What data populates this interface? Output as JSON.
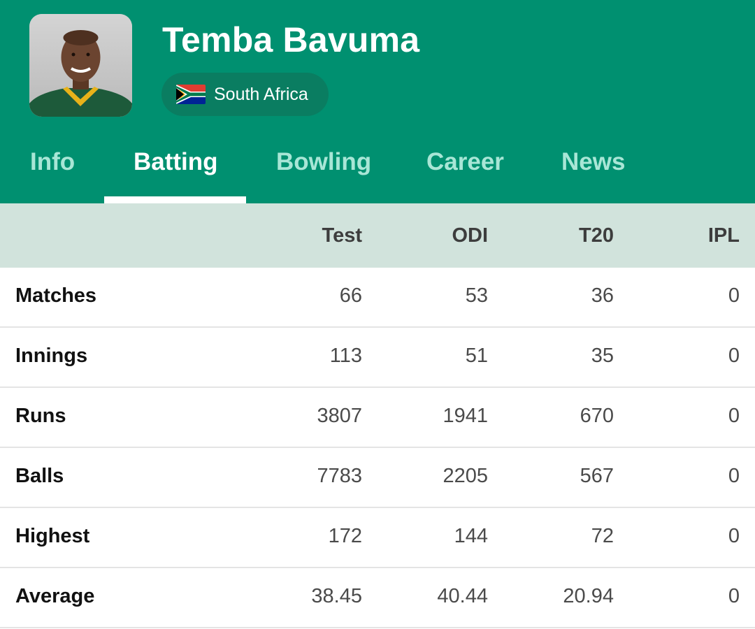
{
  "player": {
    "name": "Temba Bavuma",
    "country": "South Africa",
    "country_flag_icon": "south-africa-flag-icon",
    "photo_icon": "player-photo"
  },
  "tabs": [
    {
      "label": "Info",
      "active": false
    },
    {
      "label": "Batting",
      "active": true
    },
    {
      "label": "Bowling",
      "active": false
    },
    {
      "label": "Career",
      "active": false
    },
    {
      "label": "News",
      "active": false
    }
  ],
  "table": {
    "columns": [
      "Test",
      "ODI",
      "T20",
      "IPL"
    ],
    "rows": [
      {
        "label": "Matches",
        "values": [
          "66",
          "53",
          "36",
          "0"
        ]
      },
      {
        "label": "Innings",
        "values": [
          "113",
          "51",
          "35",
          "0"
        ]
      },
      {
        "label": "Runs",
        "values": [
          "3807",
          "1941",
          "670",
          "0"
        ]
      },
      {
        "label": "Balls",
        "values": [
          "7783",
          "2205",
          "567",
          "0"
        ]
      },
      {
        "label": "Highest",
        "values": [
          "172",
          "144",
          "72",
          "0"
        ]
      },
      {
        "label": "Average",
        "values": [
          "38.45",
          "40.44",
          "20.94",
          "0"
        ]
      }
    ]
  },
  "colors": {
    "header_bg": "#009070",
    "chip_bg": "#0a7d61",
    "inactive_tab": "#a8e6d6",
    "table_head_bg": "#d1e3dc"
  }
}
